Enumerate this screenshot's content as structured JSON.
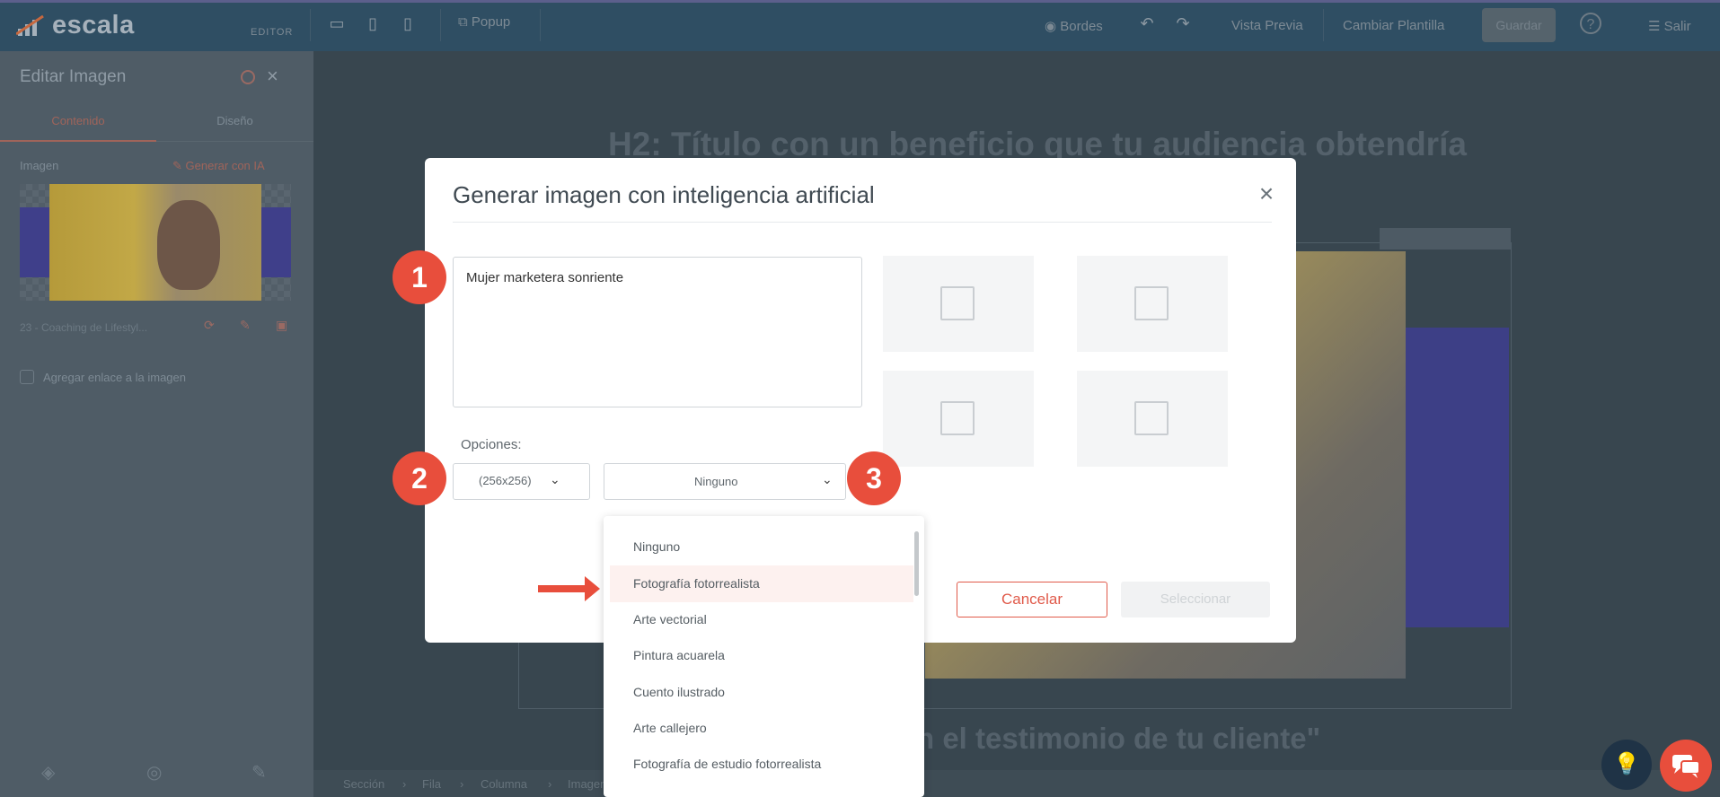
{
  "brand": {
    "logo_text": "escala",
    "editor_tag": "EDITOR",
    "accent": "#e84e3c"
  },
  "topbar": {
    "popup_label": "Popup",
    "bordes_label": "Bordes",
    "preview_label": "Vista Previa",
    "template_label": "Cambiar Plantilla",
    "save_label": "Guardar",
    "help_icon": "?",
    "exit_label": "Salir"
  },
  "sidebar": {
    "title": "Editar Imagen",
    "tabs": [
      "Contenido",
      "Diseño"
    ],
    "images_label": "Imagen",
    "generate_ai_label": "Generar con IA",
    "file_name": "23 - Coaching de Lifestyl...",
    "link_label": "Agregar enlace a la imagen"
  },
  "canvas": {
    "heading": "H2: Título con un beneficio que tu audiencia obtendría",
    "quote": "n el testimonio de tu cliente\"",
    "breadcrumb": [
      "Sección",
      "Fila",
      "Columna",
      "Imagen"
    ]
  },
  "modal": {
    "title": "Generar imagen con inteligencia artificial",
    "prompt_value": "Mujer marketera sonriente",
    "options_label": "Opciones:",
    "size_value": "(256x256)",
    "style_value": "Ninguno",
    "cancel_label": "Cancelar",
    "select_label": "Seleccionar"
  },
  "dropdown": {
    "options": [
      "Ninguno",
      "Fotografía fotorrealista",
      "Arte vectorial",
      "Pintura acuarela",
      "Cuento ilustrado",
      "Arte callejero",
      "Fotografía de estudio fotorrealista"
    ],
    "highlighted": "Fotografía fotorrealista"
  },
  "callouts": [
    "1",
    "2",
    "3"
  ]
}
